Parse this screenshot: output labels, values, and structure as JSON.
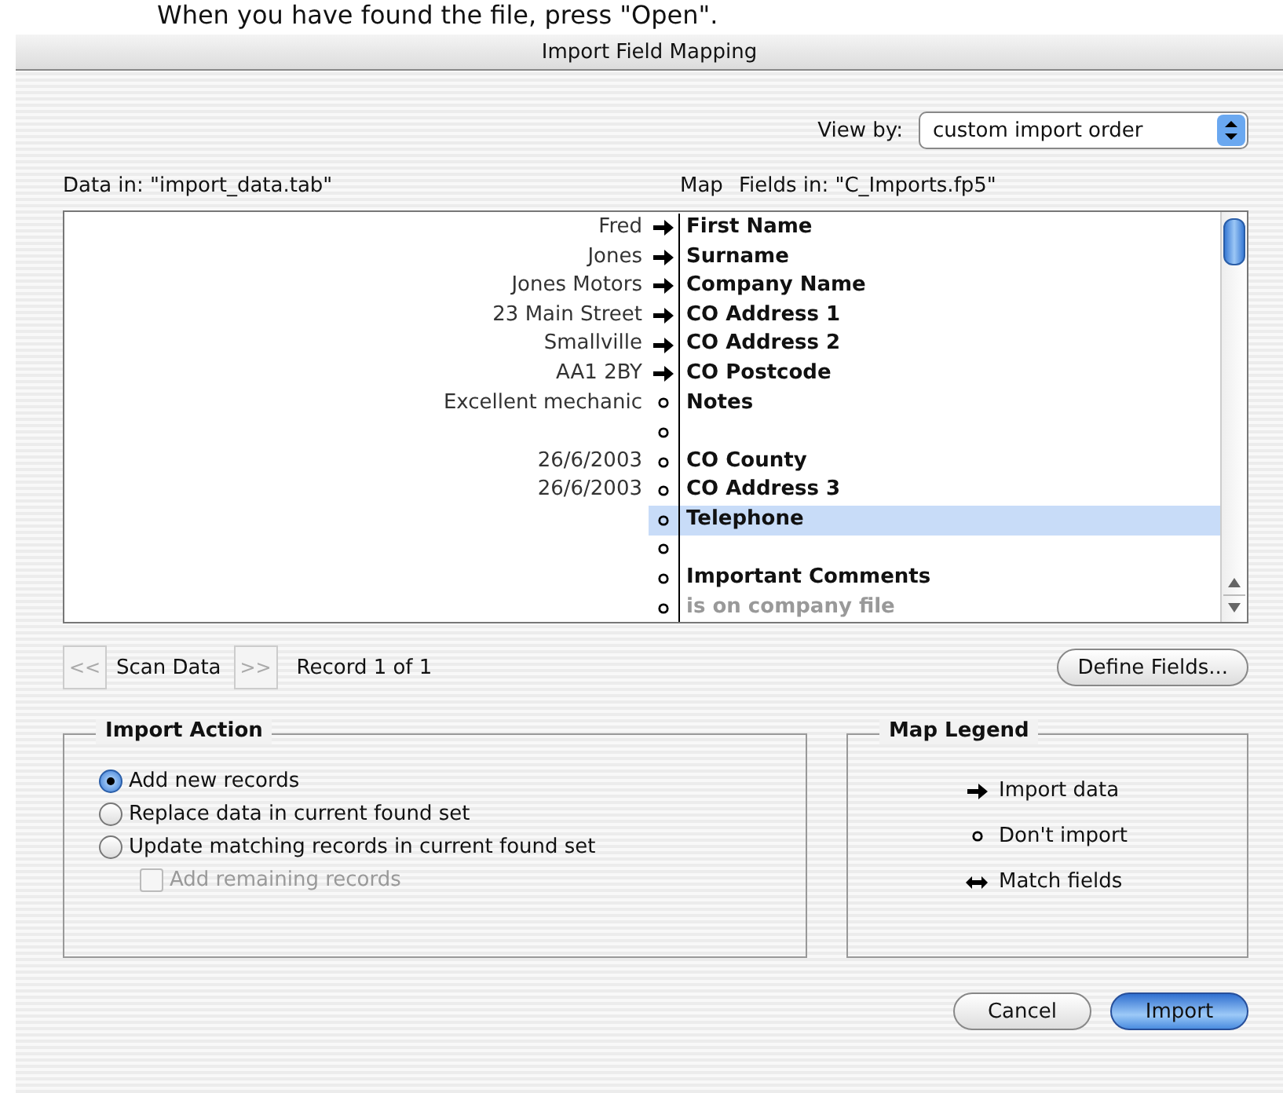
{
  "caption": "When you have found the file, press \"Open\".",
  "window": {
    "title": "Import Field Mapping"
  },
  "view_by": {
    "label": "View by:",
    "value": "custom import order"
  },
  "data_in": "Data in: \"import_data.tab\"",
  "map_label": "Map",
  "fields_in": "Fields in: \"C_Imports.fp5\"",
  "rows": [
    {
      "source": "Fred",
      "kind": "import",
      "field": "First Name",
      "disabled": false,
      "selected": false
    },
    {
      "source": "Jones",
      "kind": "import",
      "field": "Surname",
      "disabled": false,
      "selected": false
    },
    {
      "source": "Jones Motors",
      "kind": "import",
      "field": "Company Name",
      "disabled": false,
      "selected": false
    },
    {
      "source": "23 Main Street",
      "kind": "import",
      "field": "CO Address 1",
      "disabled": false,
      "selected": false
    },
    {
      "source": "Smallville",
      "kind": "import",
      "field": "CO Address 2",
      "disabled": false,
      "selected": false
    },
    {
      "source": "AA1 2BY",
      "kind": "import",
      "field": "CO Postcode",
      "disabled": false,
      "selected": false
    },
    {
      "source": "Excellent mechanic",
      "kind": "skip",
      "field": "Notes",
      "disabled": false,
      "selected": false
    },
    {
      "kind": "skip",
      "selected": false
    },
    {
      "source": "26/6/2003",
      "kind": "skip",
      "field": "CO County",
      "disabled": false,
      "selected": false
    },
    {
      "source": "26/6/2003",
      "kind": "skip",
      "field": "CO Address 3",
      "disabled": false,
      "selected": false
    },
    {
      "kind": "skip",
      "field": "Telephone",
      "disabled": false,
      "selected": true
    },
    {
      "kind": "skip",
      "selected": false
    },
    {
      "kind": "skip",
      "field": "Important Comments",
      "disabled": false,
      "selected": false
    },
    {
      "kind": "skip",
      "field": "is on company file",
      "disabled": true,
      "selected": false
    }
  ],
  "scan": {
    "prev": "<<",
    "label": "Scan Data",
    "next": ">>",
    "record": "Record 1 of 1"
  },
  "define_button": "Define Fields...",
  "import_action": {
    "title": "Import Action",
    "options": [
      {
        "label": "Add new records",
        "selected": true
      },
      {
        "label": "Replace data in current found set",
        "selected": false
      },
      {
        "label": "Update matching records in current found set",
        "selected": false
      }
    ],
    "checkbox": {
      "label": "Add remaining records",
      "checked": false,
      "disabled": true
    }
  },
  "legend": {
    "title": "Map Legend",
    "items": [
      {
        "kind": "import",
        "label": "Import data"
      },
      {
        "kind": "skip",
        "label": "Don't import"
      },
      {
        "kind": "match",
        "label": "Match fields"
      }
    ]
  },
  "buttons": [
    {
      "label": "Cancel",
      "default": false
    },
    {
      "label": "Import",
      "default": true
    }
  ]
}
